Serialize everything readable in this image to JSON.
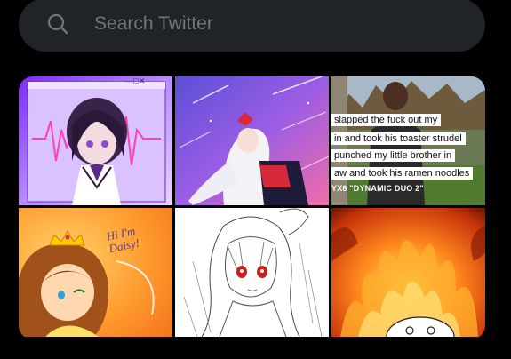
{
  "search": {
    "placeholder": "Search Twitter",
    "icon": "search-icon"
  },
  "media_grid": {
    "tiles": [
      {
        "name": "media-tile-purple-anime-girl",
        "icon": "window-controls-icon",
        "window_controls": "—□✕"
      },
      {
        "name": "media-tile-white-hair-girl-space"
      },
      {
        "name": "media-tile-meme",
        "caption_lines": [
          "slapped the fuck out my",
          "in and took his toaster strudel",
          "punched my little brother in",
          "aw and took his ramen noodles"
        ],
        "tag": "YX6 \"DYNAMIC DUO 2\""
      },
      {
        "name": "media-tile-daisy",
        "handwriting": "Hi I'm\nDaisy!"
      },
      {
        "name": "media-tile-sketch-girl"
      },
      {
        "name": "media-tile-fire"
      }
    ]
  },
  "colors": {
    "background": "#000000",
    "search_bg": "#202327",
    "placeholder": "#71767b",
    "icon": "#71767b"
  }
}
